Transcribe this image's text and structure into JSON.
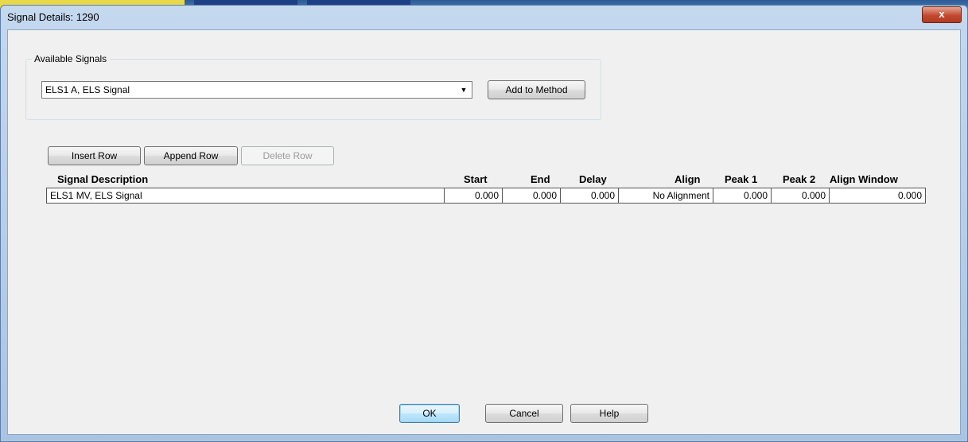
{
  "window": {
    "title": "Signal Details: 1290",
    "close_glyph": "x"
  },
  "available_signals": {
    "label": "Available Signals",
    "selected": "ELS1 A, ELS Signal",
    "add_button": "Add to Method"
  },
  "toolbar": {
    "insert_row": "Insert Row",
    "append_row": "Append Row",
    "delete_row": "Delete Row"
  },
  "table": {
    "columns": [
      "Signal Description",
      "Start",
      "End",
      "Delay",
      "Align",
      "Peak 1",
      "Peak 2",
      "Align Window"
    ],
    "rows": [
      [
        "ELS1 MV, ELS Signal",
        "0.000",
        "0.000",
        "0.000",
        "No Alignment",
        "0.000",
        "0.000",
        "0.000"
      ]
    ]
  },
  "footer": {
    "ok": "OK",
    "cancel": "Cancel",
    "help": "Help"
  },
  "icons": {
    "dropdown": "chevron-down-icon",
    "close": "close-icon"
  },
  "colors": {
    "title_bar": "#b9d1ea",
    "close_button": "#c24a30",
    "dialog_bg": "#f0f0f0"
  }
}
